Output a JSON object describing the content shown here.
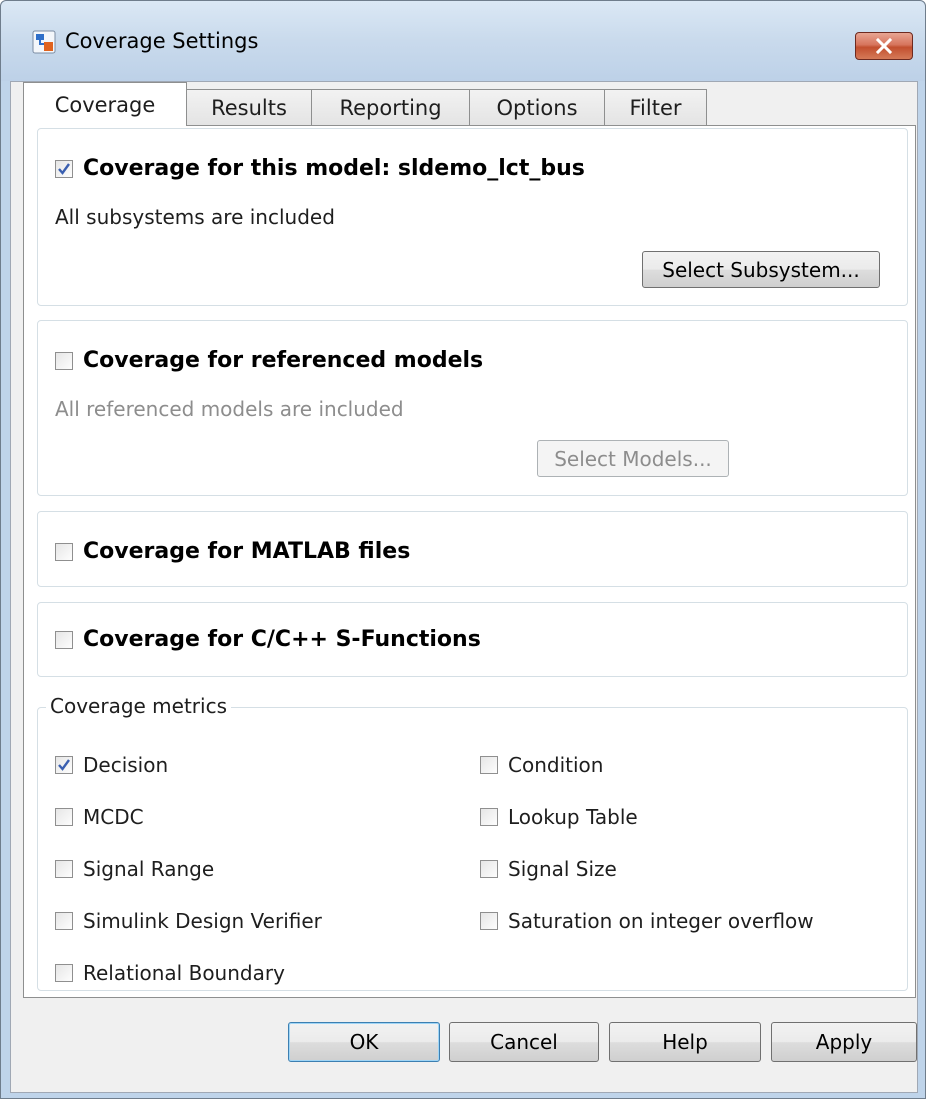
{
  "window": {
    "title": "Coverage Settings"
  },
  "tabs": [
    {
      "label": "Coverage",
      "active": true
    },
    {
      "label": "Results",
      "active": false
    },
    {
      "label": "Reporting",
      "active": false
    },
    {
      "label": "Options",
      "active": false
    },
    {
      "label": "Filter",
      "active": false
    }
  ],
  "model_section": {
    "checked": true,
    "label": "Coverage for this model: sldemo_lct_bus",
    "status": "All subsystems are included",
    "button": "Select Subsystem..."
  },
  "refmodel_section": {
    "checked": false,
    "label": "Coverage for referenced models",
    "status": "All referenced models are included",
    "button": "Select Models..."
  },
  "matlab_section": {
    "checked": false,
    "label": "Coverage for MATLAB files"
  },
  "sfunc_section": {
    "checked": false,
    "label": "Coverage for C/C++ S-Functions"
  },
  "metrics": {
    "legend": "Coverage metrics",
    "decision": {
      "label": "Decision",
      "checked": true
    },
    "condition": {
      "label": "Condition",
      "checked": false
    },
    "mcdc": {
      "label": "MCDC",
      "checked": false
    },
    "lookup_table": {
      "label": "Lookup Table",
      "checked": false
    },
    "signal_range": {
      "label": "Signal Range",
      "checked": false
    },
    "signal_size": {
      "label": "Signal Size",
      "checked": false
    },
    "sldv": {
      "label": "Simulink Design Verifier",
      "checked": false
    },
    "saturation": {
      "label": "Saturation on integer overflow",
      "checked": false
    },
    "relational_boundary": {
      "label": "Relational Boundary",
      "checked": false
    }
  },
  "buttons": {
    "ok": "OK",
    "cancel": "Cancel",
    "help": "Help",
    "apply": "Apply"
  },
  "colors": {
    "checkmark": "#3a5fb0",
    "titlebar": "#c9daec",
    "close_button": "#c24f2f"
  }
}
